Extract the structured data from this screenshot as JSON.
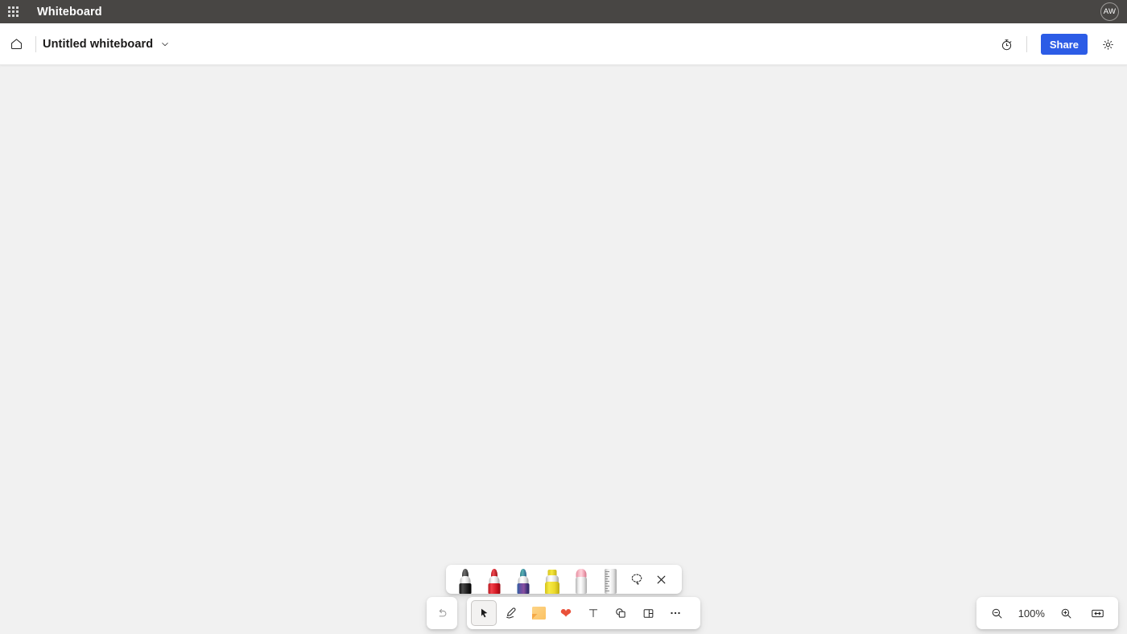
{
  "topbar": {
    "waffle_icon": "app-launcher-grid-icon",
    "app_title": "Whiteboard",
    "avatar_initials": "AW"
  },
  "subbar": {
    "home_icon": "home-icon",
    "document_title": "Untitled whiteboard",
    "title_chevron_icon": "chevron-down-icon",
    "timer_icon": "stopwatch-icon",
    "share_label": "Share",
    "settings_icon": "gear-icon",
    "accent_color": "#2c5ce6"
  },
  "canvas": {
    "background_color": "#f1f1f1"
  },
  "pen_palette": {
    "items": [
      {
        "name": "pen-black",
        "label": "Black pen",
        "color": "#1c1c1c"
      },
      {
        "name": "pen-red",
        "label": "Red pen",
        "color": "#e01b24"
      },
      {
        "name": "pen-rainbow",
        "label": "Rainbow pen",
        "color": "#5b4b9e"
      },
      {
        "name": "highlighter-yellow",
        "label": "Yellow highlighter",
        "color": "#f2e12a"
      },
      {
        "name": "eraser",
        "label": "Eraser",
        "color": "#f2aebb"
      },
      {
        "name": "ruler",
        "label": "Ruler",
        "color": "#d6d6d6"
      }
    ],
    "lasso_icon": "lasso-select-icon",
    "close_icon": "close-icon"
  },
  "toolbar": {
    "undo_icon": "undo-icon",
    "tools": [
      {
        "name": "select-tool",
        "label": "Select",
        "icon": "cursor-arrow-icon",
        "active": true
      },
      {
        "name": "pen-tool",
        "label": "Pen",
        "icon": "pen-icon",
        "active": false
      },
      {
        "name": "note-tool",
        "label": "Sticky note",
        "icon": "sticky-note-icon",
        "active": false
      },
      {
        "name": "sticker-tool",
        "label": "Sticker",
        "icon": "heart-icon",
        "active": false
      },
      {
        "name": "text-tool",
        "label": "Text",
        "icon": "text-t-icon",
        "active": false
      },
      {
        "name": "shapes-tool",
        "label": "Shapes",
        "icon": "shapes-icon",
        "active": false
      },
      {
        "name": "template-tool",
        "label": "Template",
        "icon": "template-grid-icon",
        "active": false
      },
      {
        "name": "more-tool",
        "label": "More",
        "icon": "ellipsis-icon",
        "active": false
      }
    ]
  },
  "zoom_controls": {
    "zoom_out_icon": "zoom-out-icon",
    "zoom_level": "100%",
    "zoom_in_icon": "zoom-in-icon",
    "fit_icon": "fit-to-screen-icon"
  }
}
